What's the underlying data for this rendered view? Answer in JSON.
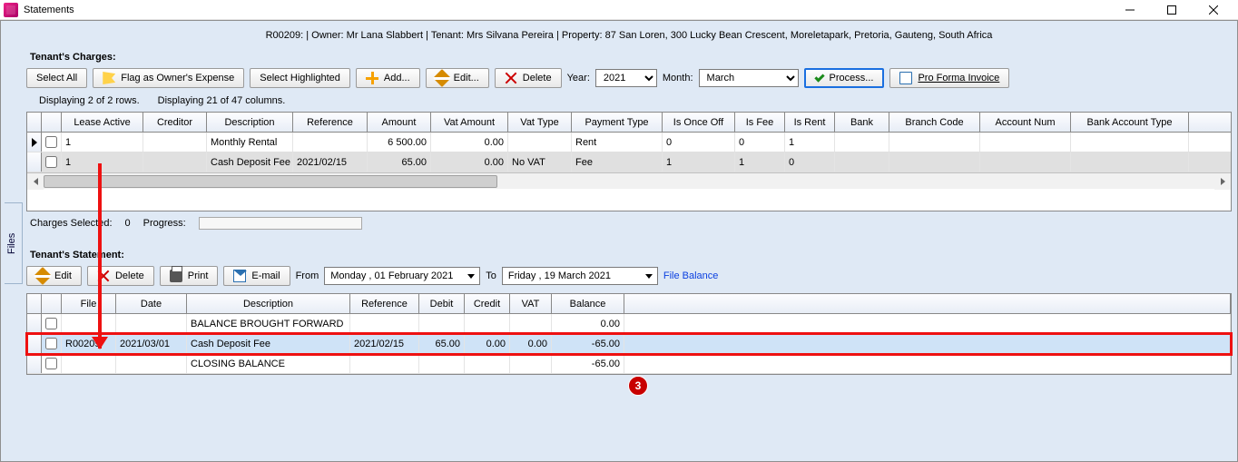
{
  "window": {
    "title": "Statements"
  },
  "header_line": "R00209:  | Owner: Mr Lana Slabbert | Tenant: Mrs Silvana Pereira | Property: 87 San Loren, 300 Lucky Bean Crescent, Moreletapark, Pretoria, Gauteng, South Africa",
  "side_tab": "Files",
  "charges": {
    "section_label": "Tenant's Charges:",
    "buttons": {
      "select_all": "Select All",
      "flag_owner": "Flag as Owner's Expense",
      "select_highlighted": "Select Highlighted",
      "add": "Add...",
      "edit": "Edit...",
      "delete": "Delete"
    },
    "year_label": "Year:",
    "year_value": "2021",
    "month_label": "Month:",
    "month_value": "March",
    "process": "Process...",
    "proforma": "Pro Forma Invoice",
    "meta_rows": "Displaying 2 of 2 rows.",
    "meta_cols": "Displaying 21 of 47 columns.",
    "columns": [
      "Lease Active",
      "Creditor",
      "Description",
      "Reference",
      "Amount",
      "Vat Amount",
      "Vat Type",
      "Payment Type",
      "Is Once Off",
      "Is Fee",
      "Is Rent",
      "Bank",
      "Branch Code",
      "Account Num",
      "Bank Account Type"
    ],
    "rows": [
      {
        "lease_active": "1",
        "creditor": "",
        "description": "Monthly Rental",
        "reference": "",
        "amount": "6 500.00",
        "vat_amount": "0.00",
        "vat_type": "",
        "payment_type": "Rent",
        "is_once_off": "0",
        "is_fee": "0",
        "is_rent": "1",
        "bank": "",
        "branch_code": "",
        "account_num": "",
        "bank_account_type": ""
      },
      {
        "lease_active": "1",
        "creditor": "",
        "description": "Cash Deposit Fee",
        "reference": "2021/02/15",
        "amount": "65.00",
        "vat_amount": "0.00",
        "vat_type": "No VAT",
        "payment_type": "Fee",
        "is_once_off": "1",
        "is_fee": "1",
        "is_rent": "0",
        "bank": "",
        "branch_code": "",
        "account_num": "",
        "bank_account_type": ""
      }
    ]
  },
  "status": {
    "charges_selected_label": "Charges Selected:",
    "charges_selected_value": "0",
    "progress_label": "Progress:"
  },
  "statement": {
    "section_label": "Tenant's Statement:",
    "buttons": {
      "edit": "Edit",
      "delete": "Delete",
      "print": "Print",
      "email": "E-mail"
    },
    "from_label": "From",
    "from_value": "Monday  , 01  February   2021",
    "to_label": "To",
    "to_value": "Friday     , 19    March      2021",
    "file_balance": "File Balance",
    "columns": [
      "File",
      "Date",
      "Description",
      "Reference",
      "Debit",
      "Credit",
      "VAT",
      "Balance"
    ],
    "rows": [
      {
        "file": "",
        "date": "",
        "description": "BALANCE BROUGHT FORWARD",
        "reference": "",
        "debit": "",
        "credit": "",
        "vat": "",
        "balance": "0.00",
        "hl": false
      },
      {
        "file": "R00209",
        "date": "2021/03/01",
        "description": "Cash Deposit Fee",
        "reference": "2021/02/15",
        "debit": "65.00",
        "credit": "0.00",
        "vat": "0.00",
        "balance": "-65.00",
        "hl": true
      },
      {
        "file": "",
        "date": "",
        "description": "CLOSING BALANCE",
        "reference": "",
        "debit": "",
        "credit": "",
        "vat": "",
        "balance": "-65.00",
        "hl": false
      }
    ]
  },
  "annotation": {
    "badge": "3"
  }
}
